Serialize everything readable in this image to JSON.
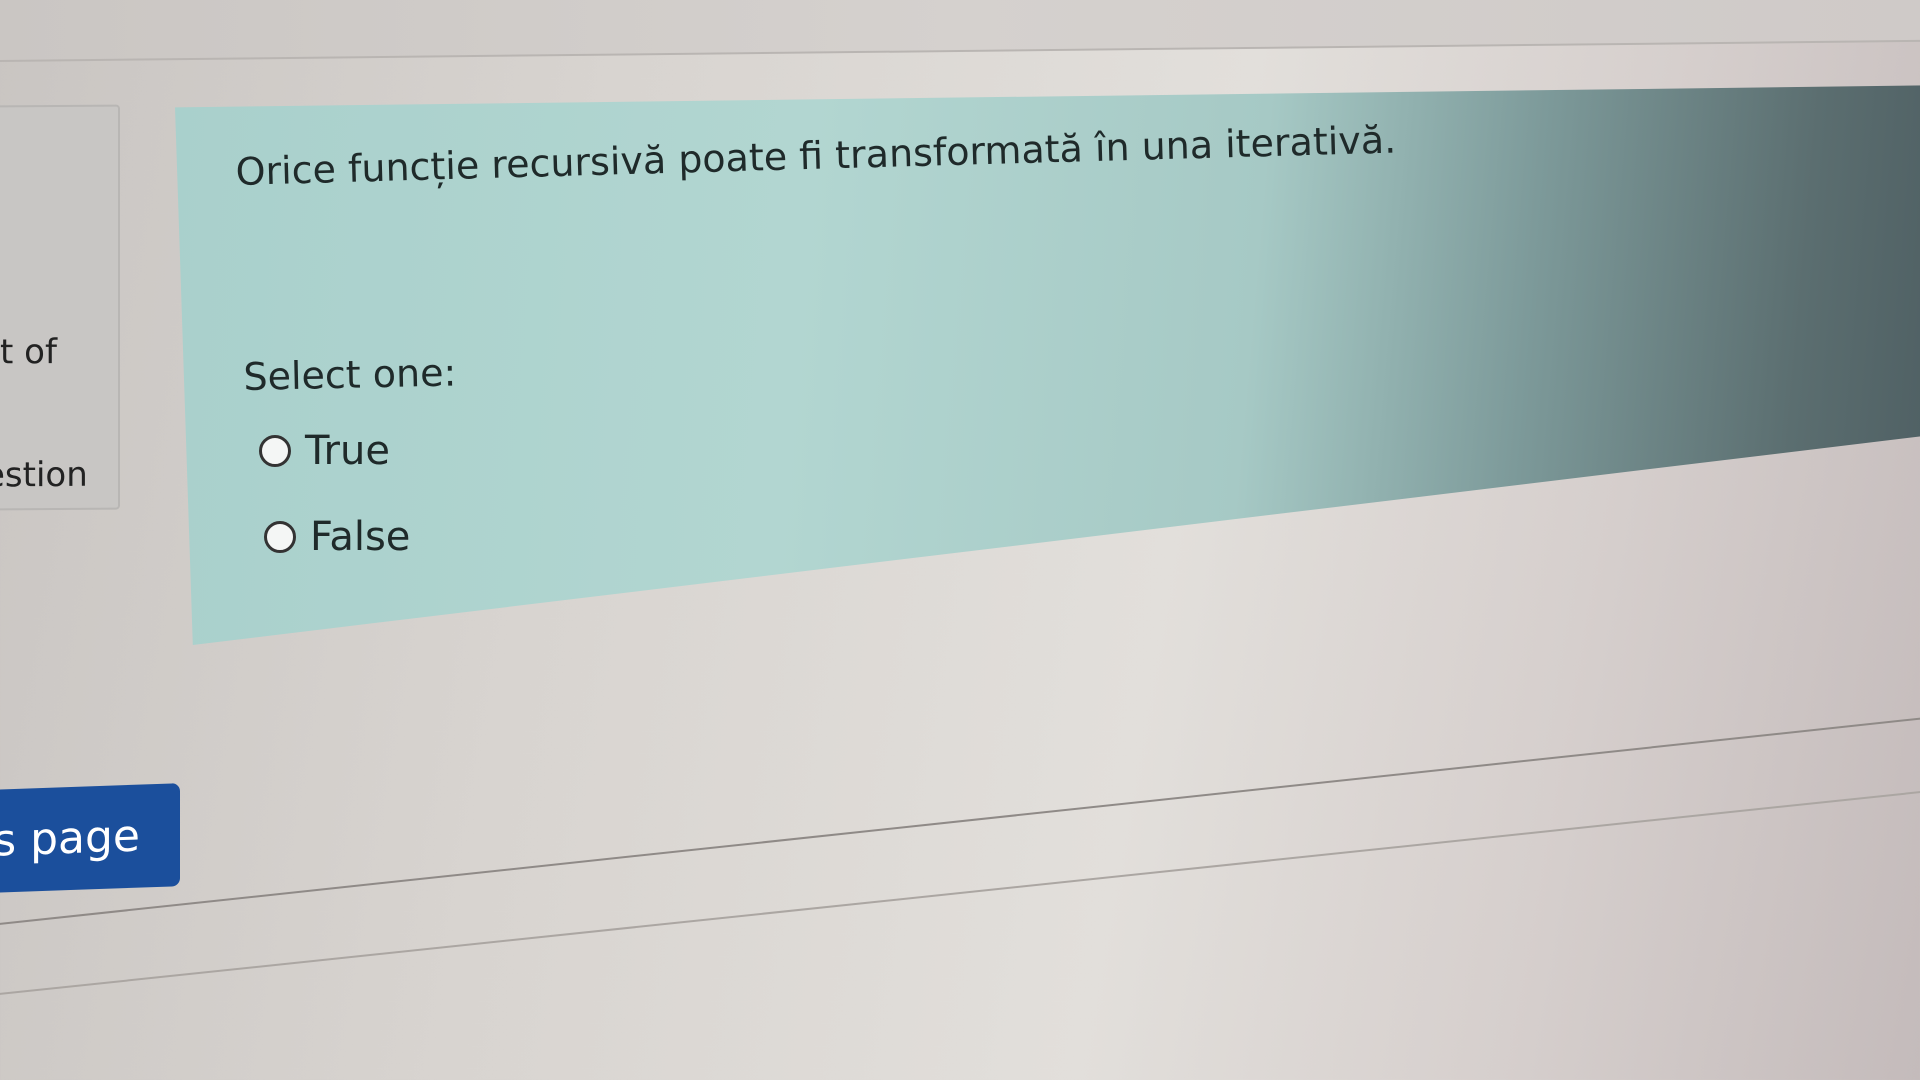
{
  "sidebar": {
    "fragment_1": "t of",
    "fragment_2": "estion"
  },
  "question": {
    "text": "Orice funcție recursivă poate fi transformată în una iterativă.",
    "prompt": "Select one:",
    "options": [
      {
        "label": "True",
        "selected": false
      },
      {
        "label": "False",
        "selected": false
      }
    ]
  },
  "navigation": {
    "button_label": "ıs page"
  },
  "colors": {
    "card_background": "#b2d6d1",
    "button_background": "#1b4f9c",
    "button_text": "#ffffff"
  }
}
